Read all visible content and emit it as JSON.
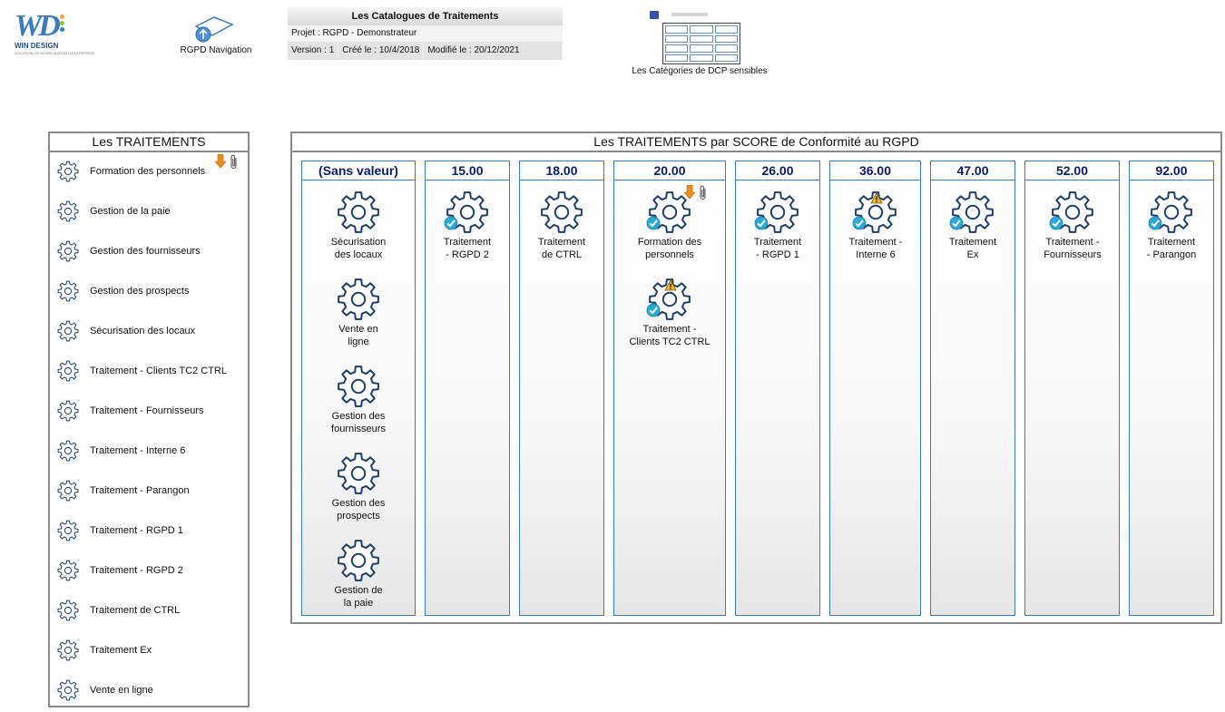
{
  "header": {
    "logo": {
      "brand": "WIN DESIGN",
      "tagline": "SOLUTION DE MODÉLISATION D'ENTREPRISE"
    },
    "navigation": {
      "label": "RGPD Navigation"
    },
    "catalogue": {
      "title": "Les Catalogues de Traitements",
      "project": "Projet : RGPD - Demonstrateur",
      "version": "Version : 1",
      "created": "Créé le : 10/4/2018",
      "modified": "Modifié le : 20/12/2021"
    },
    "dcp": {
      "label": "Les Catégories de DCP sensibles"
    }
  },
  "left_panel": {
    "title": "Les TRAITEMENTS",
    "items": [
      {
        "label": "Formation des personnels",
        "badges": true
      },
      {
        "label": "Gestion de la paie"
      },
      {
        "label": "Gestion des fournisseurs"
      },
      {
        "label": "Gestion des prospects"
      },
      {
        "label": "Sécurisation des locaux"
      },
      {
        "label": "Traitement - Clients TC2 CTRL"
      },
      {
        "label": "Traitement - Fournisseurs"
      },
      {
        "label": "Traitement - Interne 6"
      },
      {
        "label": "Traitement - Parangon"
      },
      {
        "label": "Traitement - RGPD 1"
      },
      {
        "label": "Traitement - RGPD 2"
      },
      {
        "label": "Traitement de CTRL"
      },
      {
        "label": "Traitement Ex"
      },
      {
        "label": "Vente en ligne"
      }
    ]
  },
  "right_panel": {
    "title": "Les TRAITEMENTS par SCORE de Conformité au RGPD",
    "columns": [
      {
        "score": "(Sans valeur)",
        "items": [
          {
            "line1": "Sécurisation",
            "line2": "des locaux"
          },
          {
            "line1": "Vente en",
            "line2": "ligne"
          },
          {
            "line1": "Gestion des",
            "line2": "fournisseurs"
          },
          {
            "line1": "Gestion des",
            "line2": "prospects"
          },
          {
            "line1": "Gestion de",
            "line2": "la paie"
          }
        ]
      },
      {
        "score": "15.00",
        "items": [
          {
            "line1": "Traitement",
            "line2": "- RGPD 2",
            "check": true
          }
        ]
      },
      {
        "score": "18.00",
        "items": [
          {
            "line1": "Traitement",
            "line2": "de CTRL"
          }
        ]
      },
      {
        "score": "20.00",
        "items": [
          {
            "line1": "Formation des",
            "line2": "personnels",
            "check": true,
            "badges": true
          },
          {
            "line1": "Traitement -",
            "line2": "Clients TC2 CTRL",
            "check": true,
            "warn": true
          }
        ]
      },
      {
        "score": "26.00",
        "items": [
          {
            "line1": "Traitement",
            "line2": "- RGPD 1",
            "check": true
          }
        ]
      },
      {
        "score": "36.00",
        "items": [
          {
            "line1": "Traitement -",
            "line2": "Interne 6",
            "check": true,
            "warn": true
          }
        ]
      },
      {
        "score": "47.00",
        "items": [
          {
            "line1": "Traitement",
            "line2": "Ex",
            "check": true
          }
        ]
      },
      {
        "score": "52.00",
        "items": [
          {
            "line1": "Traitement -",
            "line2": "Fournisseurs",
            "check": true
          }
        ]
      },
      {
        "score": "92.00",
        "items": [
          {
            "line1": "Traitement",
            "line2": "- Parangon",
            "check": true
          }
        ]
      }
    ]
  },
  "colors": {
    "gear": "#1f3f66",
    "score_text": "#0b1a6b",
    "column_border": "#3a7cc0",
    "check": "#29a9d8",
    "warn": "#f2b824",
    "arrow": "#f08a1c"
  }
}
